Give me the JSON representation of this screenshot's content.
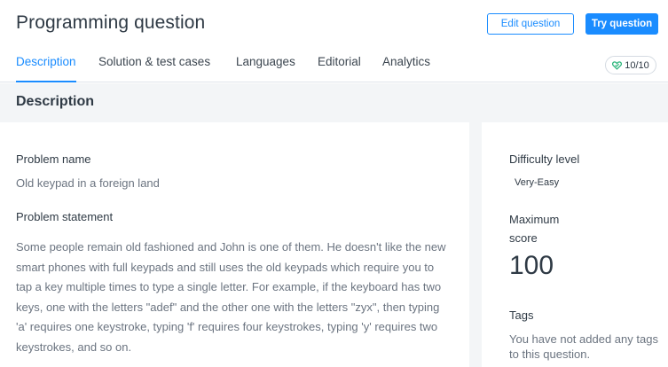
{
  "header": {
    "title": "Programming question",
    "edit_button": "Edit question",
    "try_button": "Try question"
  },
  "tabs": [
    {
      "label": "Description",
      "active": true
    },
    {
      "label": "Solution & test cases",
      "active": false
    },
    {
      "label": "Languages",
      "active": false
    },
    {
      "label": "Editorial",
      "active": false
    },
    {
      "label": "Analytics",
      "active": false
    }
  ],
  "score_badge": {
    "icon": "verified-heart-icon",
    "text": "10/10",
    "color": "#2db67c"
  },
  "section": {
    "title": "Description"
  },
  "problem": {
    "name_label": "Problem name",
    "name_value": "Old keypad in a foreign land",
    "statement_label": "Problem statement",
    "statement_text": "Some people remain old fashioned and John is one of them. He doesn't like the new smart phones with full keypads and still uses the old keypads which require you to tap a key multiple times to type a single letter. For example, if the keyboard has two keys, one with the letters \"adef\" and the other one with the letters \"zyx\", then typing 'a' requires one keystroke, typing 'f' requires four keystrokes, typing 'y' requires two keystrokes, and so on."
  },
  "sidebar": {
    "difficulty_label": "Difficulty level",
    "difficulty_value": "Very-Easy",
    "max_score_label_1": "Maximum",
    "max_score_label_2": "score",
    "max_score_value": "100",
    "tags_label": "Tags",
    "tags_text": "You have not added any tags to this question."
  },
  "colors": {
    "accent": "#1a8cff",
    "text": "#2f3a45",
    "muted": "#6b7480",
    "panel_bg": "#f3f5f7"
  }
}
